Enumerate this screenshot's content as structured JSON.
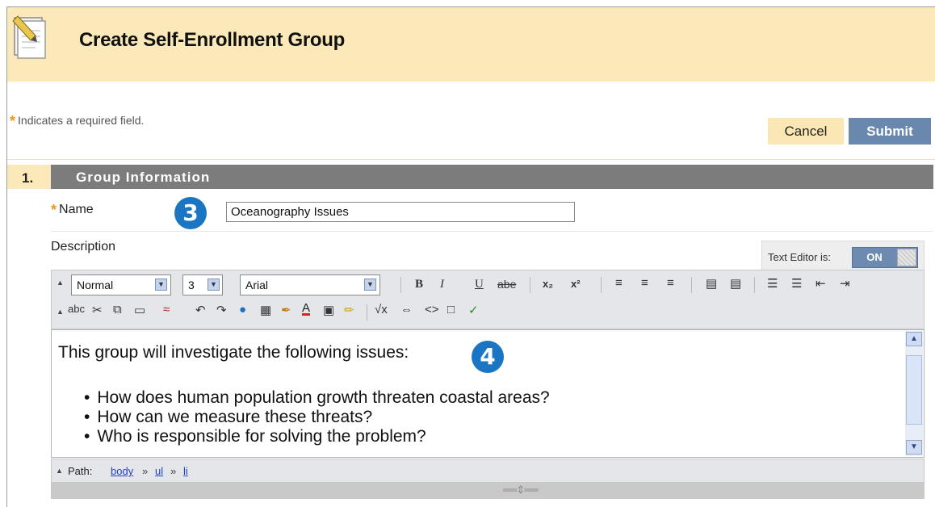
{
  "header": {
    "title": "Create Self-Enrollment Group",
    "icon": "document-pencil-icon"
  },
  "required_note": {
    "star": "*",
    "text": "Indicates a required field."
  },
  "actions": {
    "cancel_label": "Cancel",
    "submit_label": "Submit"
  },
  "section": {
    "number": "1.",
    "title": "Group Information"
  },
  "name_field": {
    "star": "*",
    "label": "Name",
    "value": "Oceanography Issues"
  },
  "callouts": {
    "step3": "3",
    "step4": "4"
  },
  "description": {
    "label": "Description"
  },
  "text_editor": {
    "label": "Text Editor is:",
    "state": "ON"
  },
  "toolbar": {
    "format_select": "Normal",
    "size_select": "3",
    "font_select": "Arial",
    "bold": "B",
    "italic": "I",
    "underline": "U",
    "strikethrough": "abe",
    "subscript": "x₂",
    "superscript": "x²",
    "spellcheck": "abc"
  },
  "editor": {
    "intro": "This group will investigate the following issues:",
    "items": [
      "How does human population growth threaten coastal areas?",
      "How can we measure these threats?",
      "Who is responsible for solving the problem?"
    ]
  },
  "pathbar": {
    "label": "Path:",
    "crumbs": [
      "body",
      "ul",
      "li"
    ],
    "separator": "»"
  },
  "colors": {
    "title_bg": "#fbe9b9",
    "submit_bg": "#6a87ad",
    "section_bg": "#7c7c7c",
    "callout": "#1a75c2",
    "star": "#f0961b"
  }
}
